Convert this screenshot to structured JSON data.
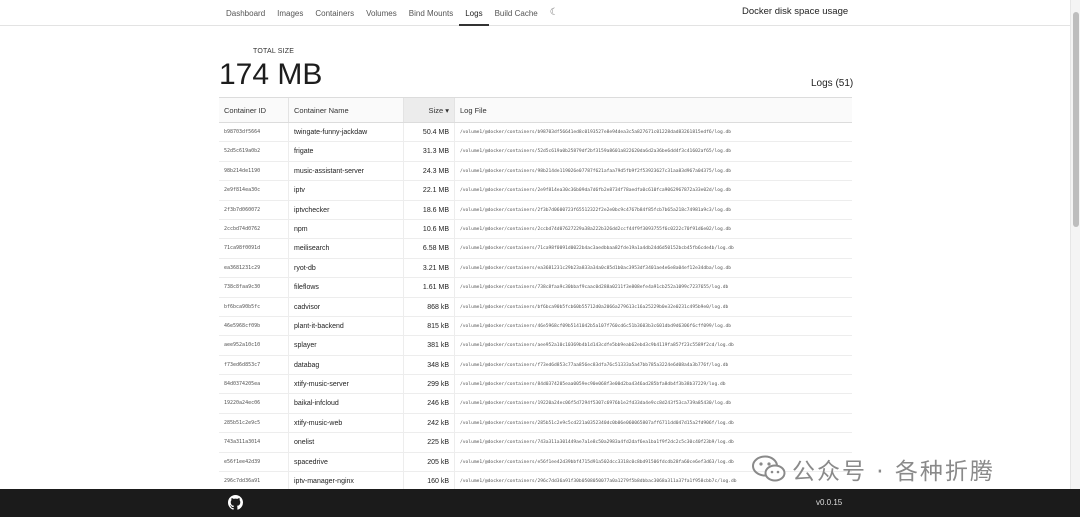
{
  "nav": {
    "tabs": [
      {
        "label": "Dashboard"
      },
      {
        "label": "Images"
      },
      {
        "label": "Containers"
      },
      {
        "label": "Volumes"
      },
      {
        "label": "Bind Mounts"
      },
      {
        "label": "Logs"
      },
      {
        "label": "Build Cache"
      }
    ],
    "active_tab": "Logs",
    "theme_icon": "moon-icon",
    "title": "Docker disk space usage"
  },
  "summary": {
    "total_label": "TOTAL SIZE",
    "total_value": "174 MB",
    "logs_count": "Logs (51)"
  },
  "table": {
    "columns": {
      "id": "Container ID",
      "name": "Container Name",
      "size": "Size ▾",
      "log": "Log File"
    },
    "rows": [
      {
        "id": "b98703df5664",
        "name": "twingate-funny-jackdaw",
        "size": "50.4 MB",
        "log": "/volume1/@docker/containers/b98703df56641ed8c0193527e8e94dea3c5a827671c01228dad83261815edf6/log.db"
      },
      {
        "id": "52d5c619a0b2",
        "name": "frigate",
        "size": "31.3 MB",
        "log": "/volume1/@docker/containers/52d5c619a0b25879df2bf3159a8601a822620da6d2a36be6dd4f3c41602af65/log.db"
      },
      {
        "id": "98b214de1190",
        "name": "music-assistant-server",
        "size": "24.3 MB",
        "log": "/volume1/@docker/containers/98b214de119026e07787f621afaa79d5fb9f2f53923627c31aa83d967a04375/log.db"
      },
      {
        "id": "2e9f814ea30c",
        "name": "iptv",
        "size": "22.1 MB",
        "log": "/volume1/@docker/containers/2e9f814ea30c36b09da7d6fb2e8734f78aedfa0c610fca9062967872a33e02d/log.db"
      },
      {
        "id": "2f3b7d060072",
        "name": "iptvchecker",
        "size": "18.6 MB",
        "log": "/volume1/@docker/containers/2f3b7d0600723f65512322f2e2e0bc9c4767b84f85fcb7b65a218c74981a9c3/log.db"
      },
      {
        "id": "2ccbd74d0762",
        "name": "npm",
        "size": "10.6 MB",
        "log": "/volume1/@docker/containers/2ccbd74d07627229a38a222b326dd2ccf44f9f3093755f6c0222c70f91d6e02/log.db"
      },
      {
        "id": "71ca98f0091d",
        "name": "meilisearch",
        "size": "6.58 MB",
        "log": "/volume1/@docker/containers/71ca98f0091d0022b4ac3aedbbaa82fde19a1a4db24d6d50152bcb45fb6cde4b/log.db"
      },
      {
        "id": "ea3681231c29",
        "name": "ryot-db",
        "size": "3.21 MB",
        "log": "/volume1/@docker/containers/ea3681231c29b23a833a34a0c85d1b0ac3953df3401ae4e6e8a04ef12e34dba/log.db"
      },
      {
        "id": "738c8faa9c30",
        "name": "fileflows",
        "size": "1.61 MB",
        "log": "/volume1/@docker/containers/738c8faa9c30bbaf9caac0d288a0211f3e808efe4a91cb252a1099c7237655/log.db"
      },
      {
        "id": "bf6bca90b5fc",
        "name": "cadvisor",
        "size": "868 kB",
        "log": "/volume1/@docker/containers/bf6bca90b5fcb60b55712d0a2066a279613c16a25229b0e32e0231c495b9e0/log.db"
      },
      {
        "id": "46e5968cf09b",
        "name": "plant-it-backend",
        "size": "815 kB",
        "log": "/volume1/@docker/containers/46e5968cf09b5141042b5a107f760cd6c51b3603b3c601dbd9d6306f6cff099/log.db"
      },
      {
        "id": "aee952a10c10",
        "name": "splayer",
        "size": "381 kB",
        "log": "/volume1/@docker/containers/aee952a10c10369b4b1d143cdfe5bb9eab62ebd3c9b4119fa857f23c5589f2cd/log.db"
      },
      {
        "id": "f73ed6d853c7",
        "name": "databag",
        "size": "348 kB",
        "log": "/volume1/@docker/containers/f73ed6d853c77aa856ec83dfa76c51333a5a47bb785a3224e6d08a4a3b776f/log.db"
      },
      {
        "id": "84d0374205ea",
        "name": "xtify-music-server",
        "size": "299 kB",
        "log": "/volume1/@docker/containers/84d0374205eaa0059ec90e068f3e00d2ba4346ad285bfa8db4f3b38b37229/log.db"
      },
      {
        "id": "19220a24ec06",
        "name": "baikal-infcloud",
        "size": "246 kB",
        "log": "/volume1/@docker/containers/19220a24ec06f5d7294f5307c6976b1e2fd33da4e9cc8d243f53ca739a85430/log.db"
      },
      {
        "id": "285b51c2e9c5",
        "name": "xtify-music-web",
        "size": "242 kB",
        "log": "/volume1/@docker/containers/285b51c2e9c5cd221a0352340dc0b06e060065807aff6711dd047d15a2fd906f/log.db"
      },
      {
        "id": "743a311a3014",
        "name": "onelist",
        "size": "225 kB",
        "log": "/volume1/@docker/containers/743a311a301449ae7a1e8c50a2983a4fd2daf6ea1ba1f9f2dc2c5c30c40f23b9/log.db"
      },
      {
        "id": "e56f1ee42d39",
        "name": "spacedrive",
        "size": "205 kB",
        "log": "/volume1/@docker/containers/e56f1ee42d39bbf4715d91a502dcc3318c0c8bd91506fdcdb28fa60ce6ef3d63/log.db"
      },
      {
        "id": "296c7dd36a91",
        "name": "iptv-manager-nginx",
        "size": "160 kB",
        "log": "/volume1/@docker/containers/296c7dd36a91f30b0508050077a0a1279f5b8dbbac3068a311a37fa1f958cbb7c/log.db"
      }
    ]
  },
  "footer": {
    "github_icon": "github-icon",
    "version": "v0.0.15"
  },
  "watermark": {
    "icon": "wechat-icon",
    "text": "公众号 · 各种折腾"
  }
}
